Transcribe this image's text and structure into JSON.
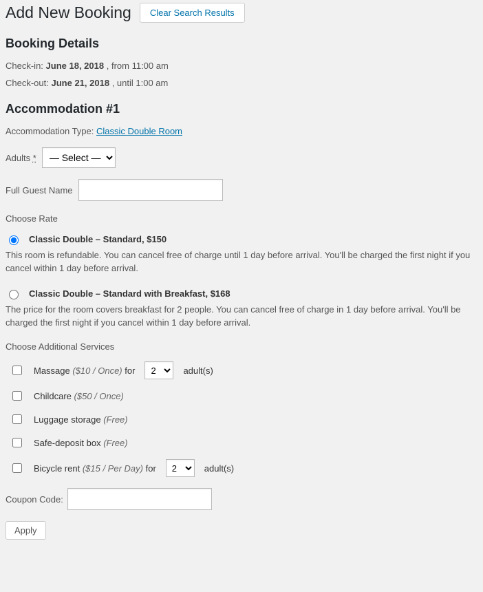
{
  "header": {
    "title": "Add New Booking",
    "clear_button": "Clear Search Results"
  },
  "booking_details": {
    "heading": "Booking Details",
    "checkin_label": "Check-in:",
    "checkin_date": "June 18, 2018",
    "checkin_suffix": ", from 11:00 am",
    "checkout_label": "Check-out:",
    "checkout_date": "June 21, 2018",
    "checkout_suffix": ", until 1:00 am"
  },
  "accommodation": {
    "heading": "Accommodation #1",
    "type_label": "Accommodation Type:",
    "type_value": "Classic Double Room",
    "adults_label": "Adults",
    "adults_required_mark": "*",
    "adults_select_placeholder": "— Select —",
    "guestname_label": "Full Guest Name"
  },
  "rates": {
    "heading": "Choose Rate",
    "options": [
      {
        "title": "Classic Double – Standard, $150",
        "desc": "This room is refundable. You can cancel free of charge until 1 day before arrival. You'll be charged the first night if you cancel within 1 day before arrival.",
        "selected": true
      },
      {
        "title": "Classic Double – Standard with Breakfast, $168",
        "desc": "The price for the room covers breakfast for 2 people. You can cancel free of charge in 1 day before arrival. You'll be charged the first night if you cancel within 1 day before arrival.",
        "selected": false
      }
    ]
  },
  "services": {
    "heading": "Choose Additional Services",
    "for_label": "for",
    "adults_unit": "adult(s)",
    "items": [
      {
        "name": "Massage",
        "price": "($10 / Once)",
        "qty": "2",
        "has_qty": true
      },
      {
        "name": "Childcare",
        "price": "($50 / Once)",
        "has_qty": false
      },
      {
        "name": "Luggage storage",
        "price": "(Free)",
        "has_qty": false
      },
      {
        "name": "Safe-deposit box",
        "price": "(Free)",
        "has_qty": false
      },
      {
        "name": "Bicycle rent",
        "price": "($15 / Per Day)",
        "qty": "2",
        "has_qty": true
      }
    ]
  },
  "coupon": {
    "label": "Coupon Code:",
    "apply": "Apply"
  }
}
